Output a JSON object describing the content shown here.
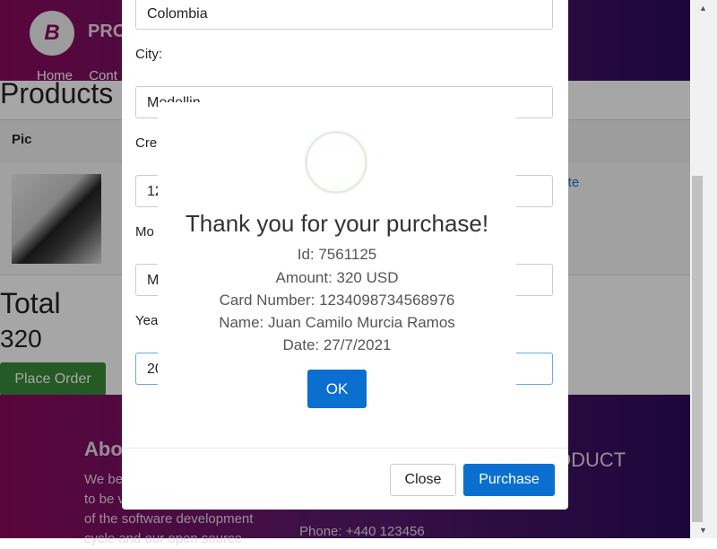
{
  "header": {
    "logo_letter": "B",
    "brand": "PRO",
    "nav": [
      "Home",
      "Cont"
    ]
  },
  "products": {
    "title": "Products",
    "columns": [
      "Pic"
    ],
    "row_action": "lete"
  },
  "total": {
    "label": "Total",
    "value": "320",
    "place_order": "Place Order"
  },
  "footer": {
    "about_title": "Abo",
    "about_lines": [
      "We be",
      "to be v",
      "of the software development",
      "cycle and our open source"
    ],
    "product_title": "ODUCT",
    "phone": "Phone: +440 123456"
  },
  "modal": {
    "country_value": "Colombia",
    "city_label": "City:",
    "city_value": "Medellin",
    "credit_label": "Cre",
    "credit_value": "12",
    "month_label": "Mo",
    "month_value": "M",
    "year_label": "Year",
    "year_value": "20",
    "close_label": "Close",
    "purchase_label": "Purchase"
  },
  "alert": {
    "title": "Thank you for your purchase!",
    "id": "Id: 7561125",
    "amount": "Amount: 320 USD",
    "card": "Card Number: 1234098734568976",
    "name": "Name: Juan Camilo Murcia Ramos",
    "date": "Date: 27/7/2021",
    "ok_label": "OK"
  },
  "scrollbar": {
    "up_icon": "triangle-up",
    "down_icon": "triangle-down"
  }
}
